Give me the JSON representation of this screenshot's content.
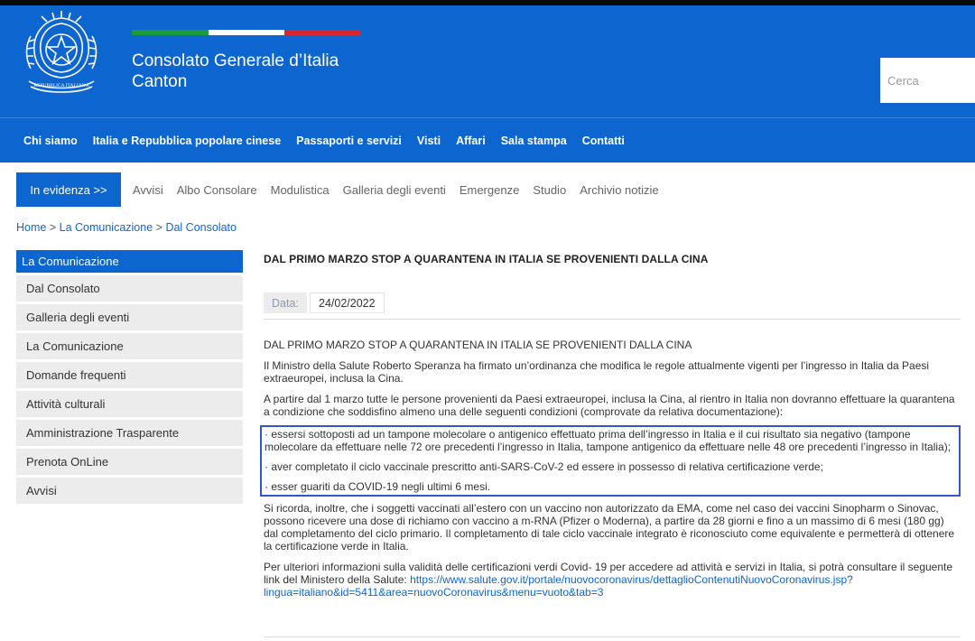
{
  "header": {
    "title_line1": "Consolato Generale d’Italia",
    "title_line2": "Canton",
    "emblem_text": "REPUBBLICA ITALIANA",
    "flag_colors": [
      "#1a9b3c",
      "#ffffff",
      "#d9262e"
    ],
    "search": {
      "placeholder": "Cerca",
      "value": ""
    }
  },
  "colors": {
    "brand": "#0d66d0",
    "highlight_border": "#3454c8",
    "sidebar_bg": "#ececec"
  },
  "main_nav": [
    "Chi siamo",
    "Italia e Repubblica popolare cinese",
    "Passaporti e servizi",
    "Visti",
    "Affari",
    "Sala stampa",
    "Contatti"
  ],
  "evidenza_button": "In evidenza >>",
  "sub_nav": [
    "Avvisi",
    "Albo Consolare",
    "Modulistica",
    "Galleria degli eventi",
    "Emergenze",
    "Studio",
    "Archivio notizie"
  ],
  "breadcrumb": {
    "items": [
      "Home",
      "La Comunicazione",
      "Dal Consolato"
    ],
    "separator": ">"
  },
  "sidebar": {
    "header": "La Comunicazione",
    "items": [
      "Dal Consolato",
      "Galleria degli eventi",
      "La Comunicazione",
      "Domande frequenti",
      "Attività culturali",
      "Amministrazione Trasparente",
      "Prenota OnLine",
      "Avvisi"
    ]
  },
  "article": {
    "title": "DAL PRIMO MARZO STOP A QUARANTENA IN ITALIA SE PROVENIENTI DALLA CINA",
    "date_label": "Data:",
    "date_value": "24/02/2022",
    "paragraphs": {
      "p0": "DAL PRIMO MARZO STOP A QUARANTENA IN ITALIA SE PROVENIENTI DALLA CINA",
      "p1": "Il Ministro della Salute Roberto Speranza ha firmato un’ordinanza che modifica le regole attualmente vigenti per l’ingresso in Italia da Paesi extraeuropei, inclusa la Cina.",
      "p2": "A partire dal 1 marzo tutte le persone provenienti da Paesi extraeuropei, inclusa la Cina, al rientro in Italia non dovranno effettuare la quarantena a condizione che soddisfino almeno una delle seguenti condizioni (comprovate da relativa documentazione):",
      "c1": "· essersi sottoposti ad un tampone molecolare o antigenico effettuato prima dell’ingresso in Italia e il cui risultato sia negativo (tampone molecolare da effettuare nelle 72 ore precedenti l’ingresso in Italia, tampone antigenico da effettuare nelle 48 ore precedenti l’ingresso in Italia);",
      "c2": "· aver completato il ciclo vaccinale prescritto anti-SARS-CoV-2 ed essere in possesso di relativa certificazione verde;",
      "c3": "· esser guariti da COVID-19 negli ultimi 6 mesi.",
      "p3": "Si ricorda, inoltre, che i soggetti vaccinati all’estero con un vaccino non autorizzato da EMA, come nel caso dei vaccini Sinopharm o Sinovac, possono ricevere una dose di richiamo con vaccino a m-RNA (Pfizer o Moderna), a partire da 28 giorni e fino a un massimo di 6 mesi (180 gg) dal completamento del ciclo primario. Il completamento di tale ciclo vaccinale integrato è riconosciuto come equivalente e permetterà di ottenere la certificazione verde in Italia.",
      "p4_text": "Per ulteriori informazioni sulla validità delle certificazioni verdi Covid- 19 per accedere ad attività e servizi in Italia, si potrà consultare il seguente link del Ministero della Salute: ",
      "p4_link": "https://www.salute.gov.it/portale/nuovocoronavirus/dettaglioContenutiNuovoCoronavirus.jsp?lingua=italiano&id=5411&area=nuovoCoronavirus&menu=vuoto&tab=3"
    }
  }
}
